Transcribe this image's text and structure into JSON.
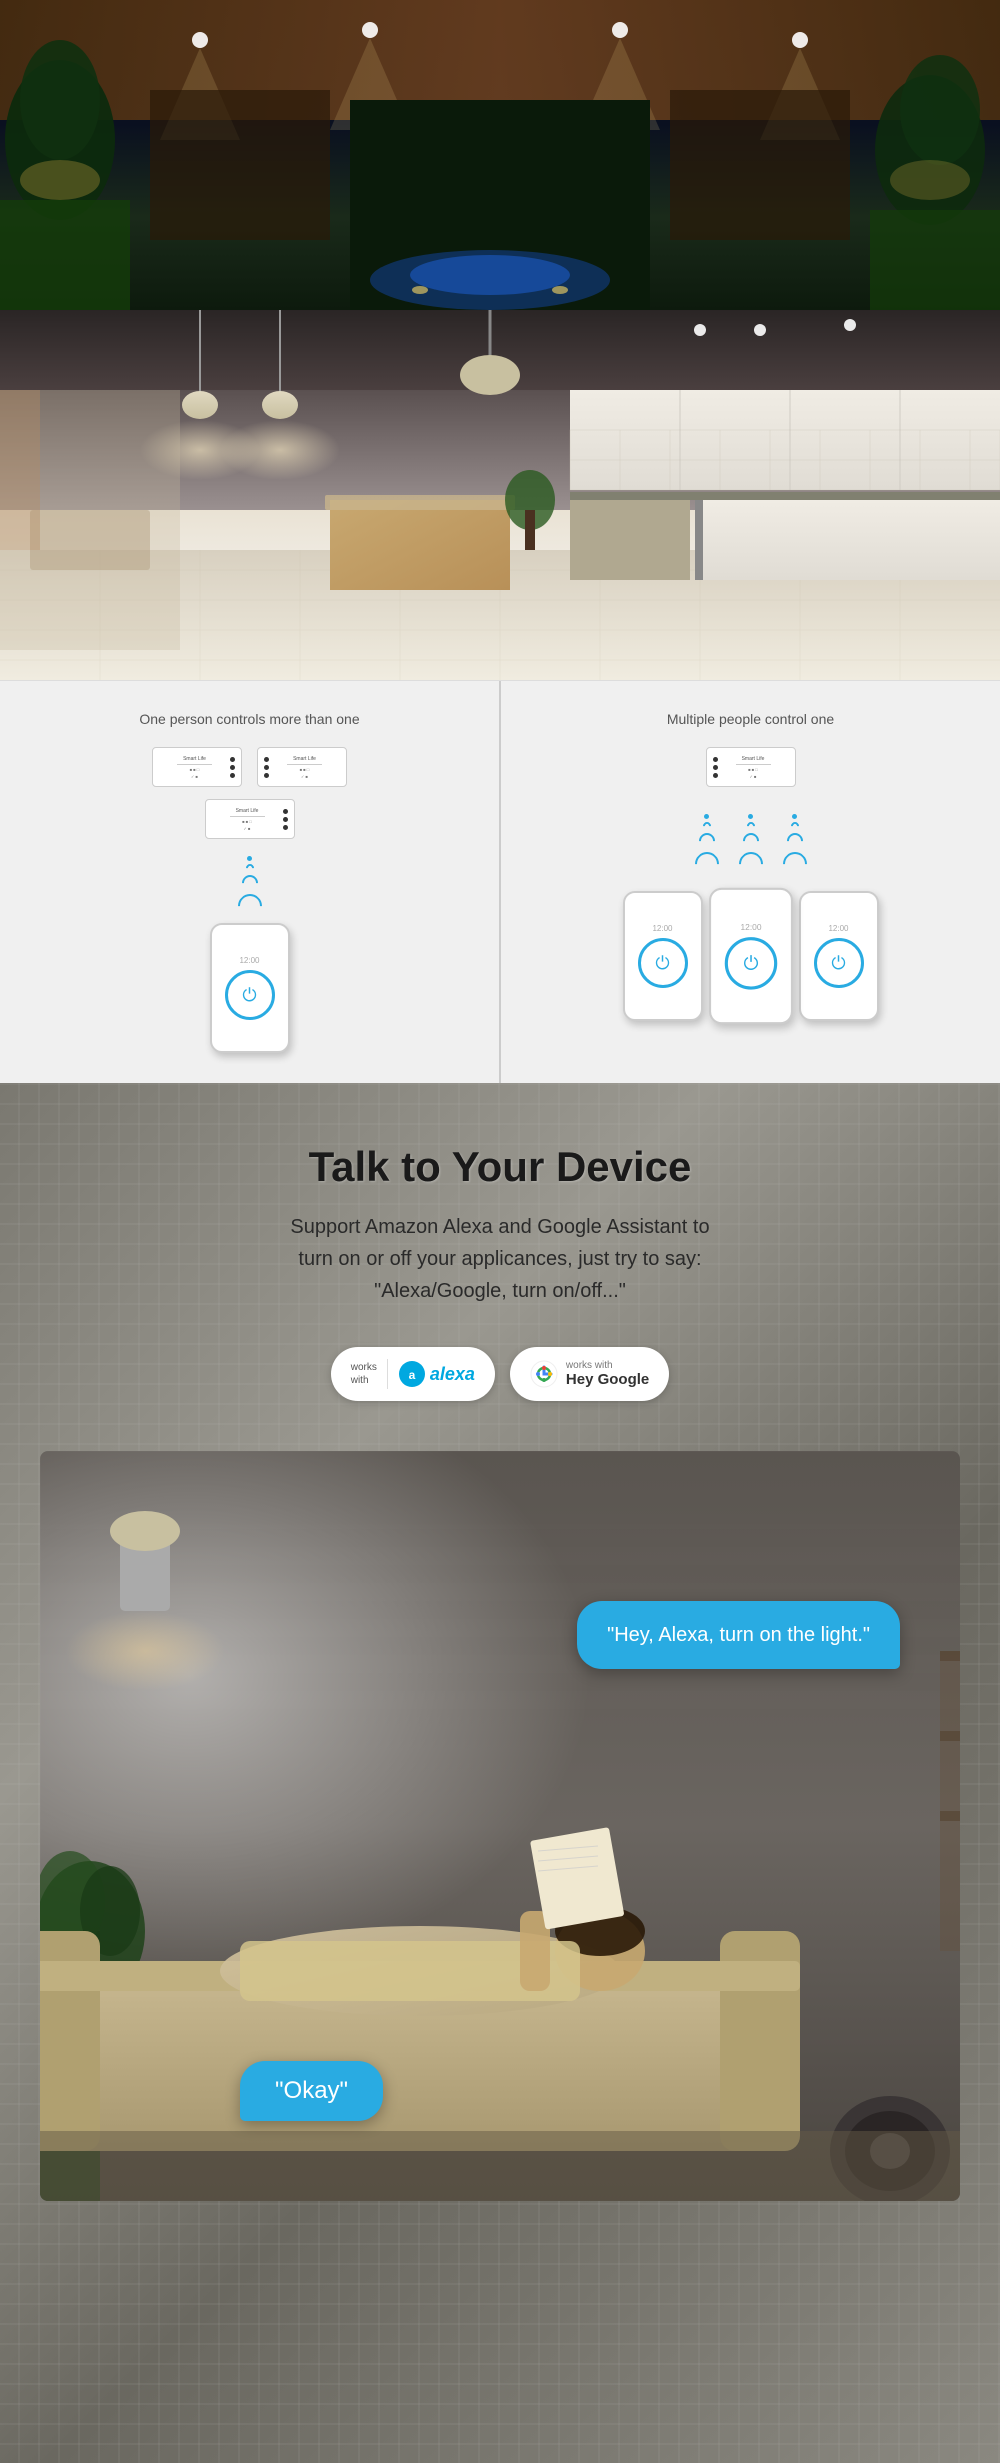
{
  "hero": {
    "outdoor_alt": "Smart home outdoor night scene with uplighting and trees",
    "kitchen_alt": "Modern kitchen interior with pendant lights and island"
  },
  "control_diagram": {
    "left_title": "One person controls more than one",
    "right_title": "Multiple people control one",
    "wifi_symbol": "WiFi",
    "phone_icon": "⏻"
  },
  "voice_section": {
    "title": "Talk to Your Device",
    "subtitle": "Support Amazon Alexa and Google Assistant to turn on or off your applicances, just try to say: \"Alexa/Google, turn on/off...\"",
    "alexa_works_line1": "works",
    "alexa_works_line2": "with",
    "alexa_logo_text": "alexa",
    "google_works_text": "works with",
    "google_assistant_text": "Hey Google",
    "speech_bubble_right": "\"Hey, Alexa, turn on the light.\"",
    "speech_bubble_left": "\"Okay\""
  }
}
